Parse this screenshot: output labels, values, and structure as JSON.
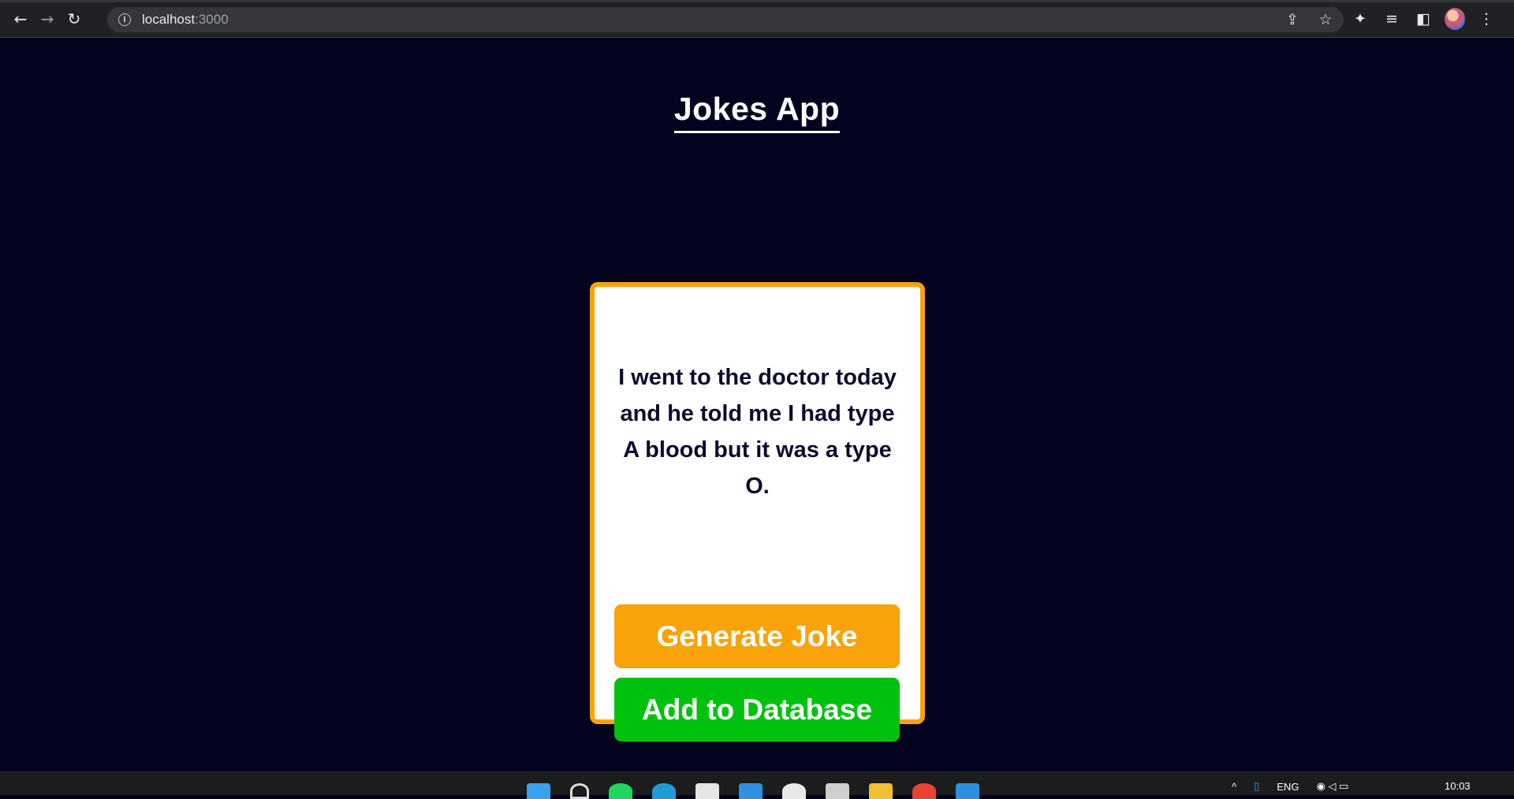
{
  "browser": {
    "url_host": "localhost",
    "url_port": ":3000",
    "icons": {
      "back": "←",
      "forward": "→",
      "reload": "↻",
      "share": "⇪",
      "star": "☆",
      "extensions": "✦",
      "media": "≡",
      "sidepanel": "◧",
      "menu": "⋮"
    }
  },
  "page": {
    "title": "Jokes App",
    "joke_text": "I went to the doctor today and he told me I had type A blood but it was a type O.",
    "generate_label": "Generate Joke",
    "add_label": "Add to Database"
  },
  "colors": {
    "background": "#03021f",
    "accent_orange": "#f9a20a",
    "accent_green": "#00c20e"
  },
  "taskbar": {
    "language": "ENG",
    "time": "10:03",
    "apps": [
      "windows",
      "search",
      "spotify",
      "edge",
      "store",
      "app",
      "app",
      "app",
      "explorer",
      "chrome",
      "vscode"
    ]
  }
}
